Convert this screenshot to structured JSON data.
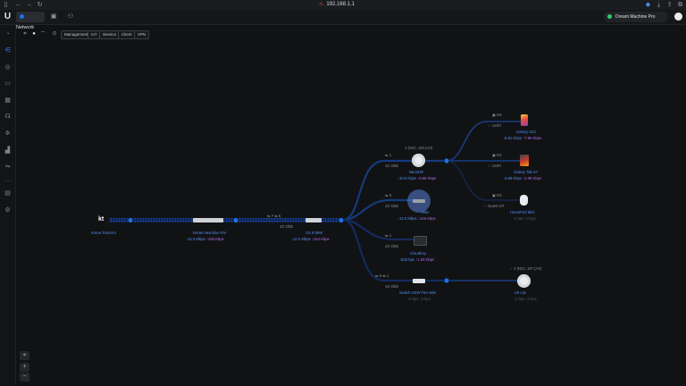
{
  "browser": {
    "url": "192.168.1.1"
  },
  "header": {
    "app_tab": "Network",
    "device_selector": "Dream Machine Pro"
  },
  "filters": [
    "Management",
    "IoT",
    "Service",
    "Client",
    "VPN"
  ],
  "nodes": {
    "isp": {
      "name": "Korea Telecom",
      "logo": "kt"
    },
    "gateway": {
      "name": "Dream Machine Pro",
      "down": "12.0 Mbps",
      "up": "156 Kbps"
    },
    "switch": {
      "name": "US 8 60W",
      "down": "12.0 Mbps",
      "up": "154 Kbps",
      "ports": "7",
      "ports2": "5",
      "uplink": "1G GbE"
    },
    "ap_nanohd": {
      "name": "NanoHD",
      "down": "10.5 Kbps",
      "up": "9.56 Kbps",
      "meta": "1 (NG), 153 (AX)",
      "p1": "1",
      "link": "1G GbE"
    },
    "client_mid": {
      "name": "wlan",
      "down": "12.0 Mbps",
      "up": "145 Kbps",
      "p1": "6",
      "link": "1G GbE"
    },
    "cloudkey": {
      "name": "CloudKey",
      "down": "536 bps",
      "up": "1.09 Kbps",
      "p1": "1",
      "link": "1G GbE"
    },
    "flex_mini": {
      "name": "Switch USW Flex Mini",
      "down": "0 bps",
      "up": "0 bps",
      "p1": "6",
      "p2": "1",
      "link": "1G GbE"
    },
    "phone": {
      "name": "Galaxy S23",
      "down": "6.61 Kbps",
      "up": "7.90 Kbps",
      "band": "5G",
      "ssid": "UniFi"
    },
    "tablet": {
      "name": "Galaxy Tab S7",
      "down": "3.89 Kbps",
      "up": "2.08 Kbps",
      "band": "5G",
      "ssid": "UniFi"
    },
    "homepod": {
      "name": "HomePod Mini",
      "down": "0 bps",
      "up": "0 bps",
      "band": "5G",
      "ssid": "Guest-IoT"
    },
    "ap_u6lite": {
      "name": "U6 Lite",
      "down": "0 bps",
      "up": "0 bps",
      "meta": "4 (NG), 157 (AX)"
    }
  },
  "colors": {
    "accent": "#1f6feb",
    "down": "#5b8ef0",
    "up": "#b06ee8",
    "link": "#1b3d82"
  }
}
